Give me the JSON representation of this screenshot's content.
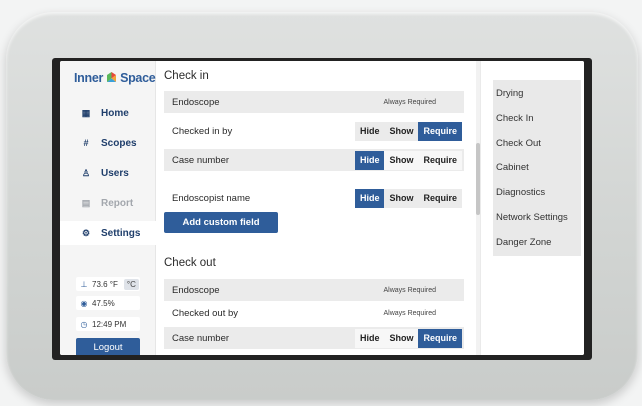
{
  "brand": {
    "name_part1": "Inner",
    "name_part2": "Space"
  },
  "sidebar": {
    "items": [
      {
        "label": "Home",
        "icon": "grid-icon"
      },
      {
        "label": "Scopes",
        "icon": "hashtag-icon"
      },
      {
        "label": "Users",
        "icon": "user-icon"
      },
      {
        "label": "Report",
        "icon": "report-icon"
      },
      {
        "label": "Settings",
        "icon": "gear-icon"
      }
    ],
    "status": {
      "temperature": "73.6 °F",
      "temp_alt_unit": "°C",
      "humidity": "47.5%",
      "time": "12:49 PM"
    },
    "logout_label": "Logout"
  },
  "checkin": {
    "title": "Check in",
    "rows": [
      {
        "label": "Endoscope",
        "value": "Always Required"
      },
      {
        "label": "Checked in by",
        "options": [
          "Hide",
          "Show",
          "Require"
        ],
        "selected": "Require"
      },
      {
        "label": "Case number",
        "options": [
          "Hide",
          "Show",
          "Require"
        ],
        "selected": "Hide"
      },
      {
        "label": "Endoscopist name",
        "options": [
          "Hide",
          "Show",
          "Require"
        ],
        "selected": "Hide"
      }
    ],
    "add_button": "Add custom field"
  },
  "checkout": {
    "title": "Check out",
    "rows": [
      {
        "label": "Endoscope",
        "value": "Always Required"
      },
      {
        "label": "Checked out by",
        "value": "Always Required"
      },
      {
        "label": "Case number",
        "options": [
          "Hide",
          "Show",
          "Require"
        ],
        "selected": "Require"
      }
    ]
  },
  "right_nav": {
    "items": [
      "Drying",
      "Check In",
      "Check Out",
      "Cabinet",
      "Diagnostics",
      "Network Settings",
      "Danger Zone"
    ]
  },
  "colors": {
    "accent": "#2f5d9a",
    "logo_flower": [
      "#e8473b",
      "#f2a23a",
      "#3aa0d8",
      "#5bb85a"
    ]
  }
}
